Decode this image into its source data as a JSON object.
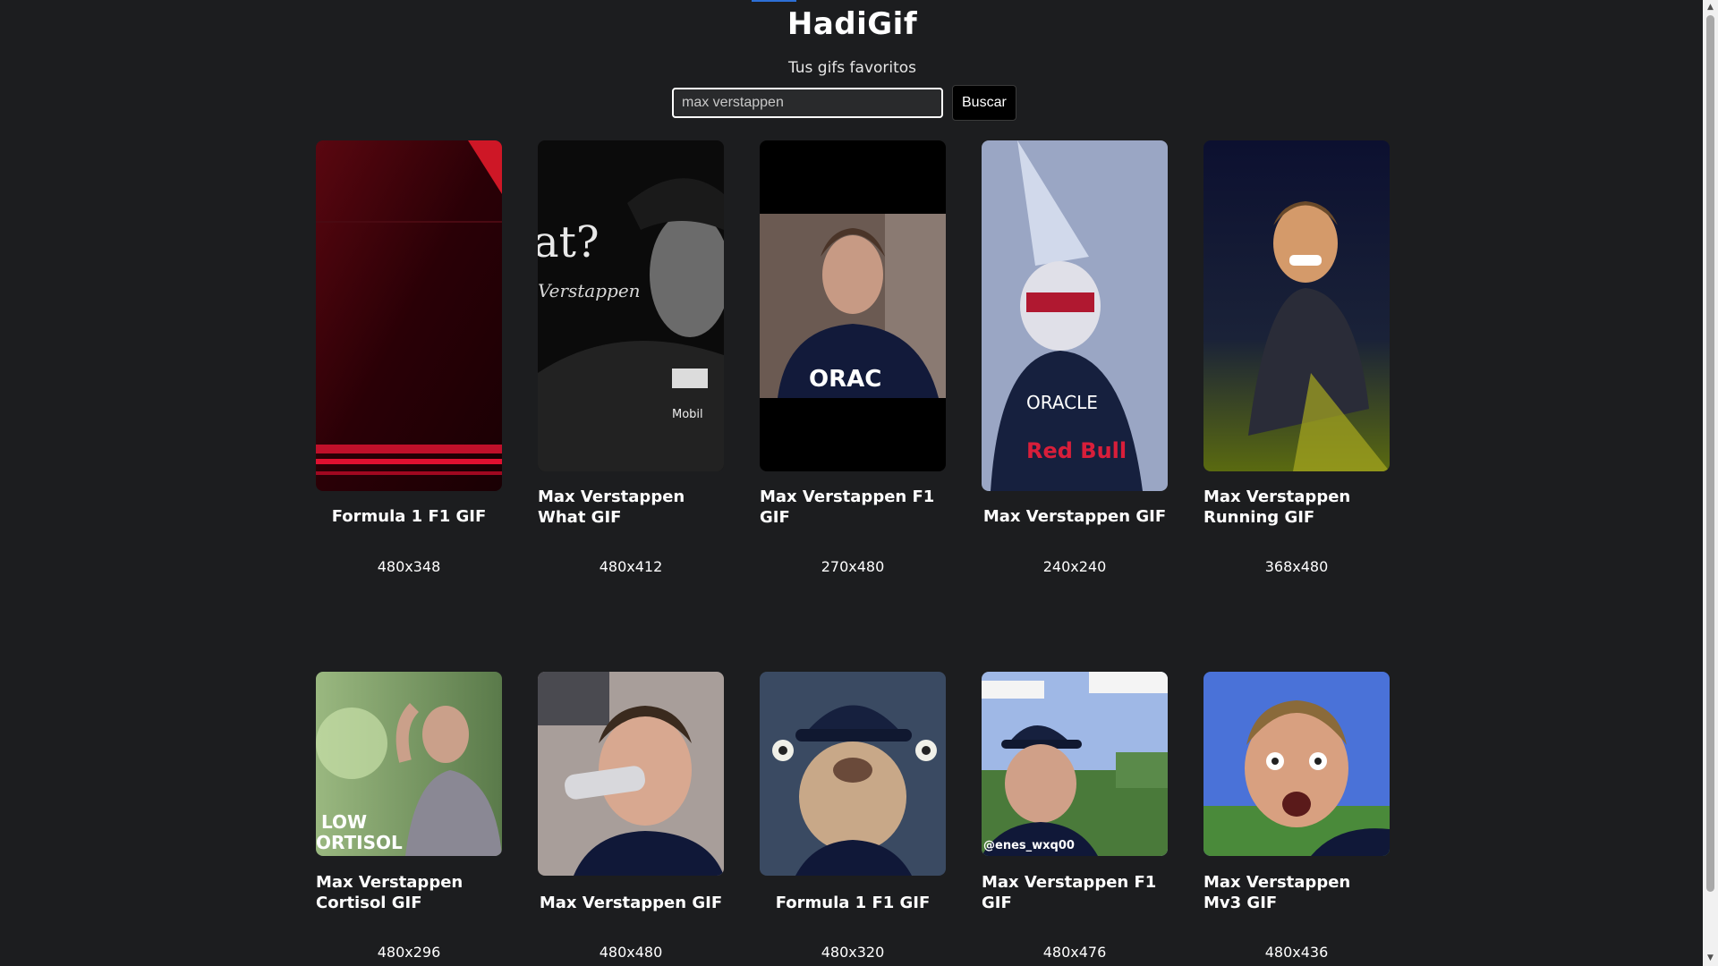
{
  "header": {
    "title": "HadiGif",
    "subtitle": "Tus gifs favoritos"
  },
  "search": {
    "value": "max verstappen",
    "button_label": "Buscar"
  },
  "colors": {
    "background": "#1c1d1f",
    "text": "#ffffff",
    "accent": "#2d6fd6"
  },
  "gifs": [
    {
      "title": "Formula 1 F1 GIF",
      "size": "480x348",
      "icon": "red-motion-blur-image"
    },
    {
      "title": "Max Verstappen What GIF",
      "size": "480x412",
      "icon": "black-and-white-interview-image"
    },
    {
      "title": "Max Verstappen F1 GIF",
      "size": "270x480",
      "icon": "driver-portrait-image"
    },
    {
      "title": "Max Verstappen GIF",
      "size": "240x240",
      "icon": "driver-helmet-celebration-image"
    },
    {
      "title": "Max Verstappen Running GIF",
      "size": "368x480",
      "icon": "driver-running-image"
    },
    {
      "title": "Max Verstappen Cortisol GIF",
      "size": "480x296",
      "icon": "low-cortisol-image",
      "overlay": "LOW\nCORTISOL"
    },
    {
      "title": "Max Verstappen GIF",
      "size": "480x480",
      "icon": "driver-drinking-image"
    },
    {
      "title": "Formula 1 F1 GIF",
      "size": "480x320",
      "icon": "sloth-in-cap-image"
    },
    {
      "title": "Max Verstappen F1 GIF",
      "size": "480x476",
      "icon": "minecraft-background-image",
      "overlay": "@enes_wxq00"
    },
    {
      "title": "Max Verstappen Mv3 GIF",
      "size": "480x436",
      "icon": "surprised-face-image"
    }
  ]
}
